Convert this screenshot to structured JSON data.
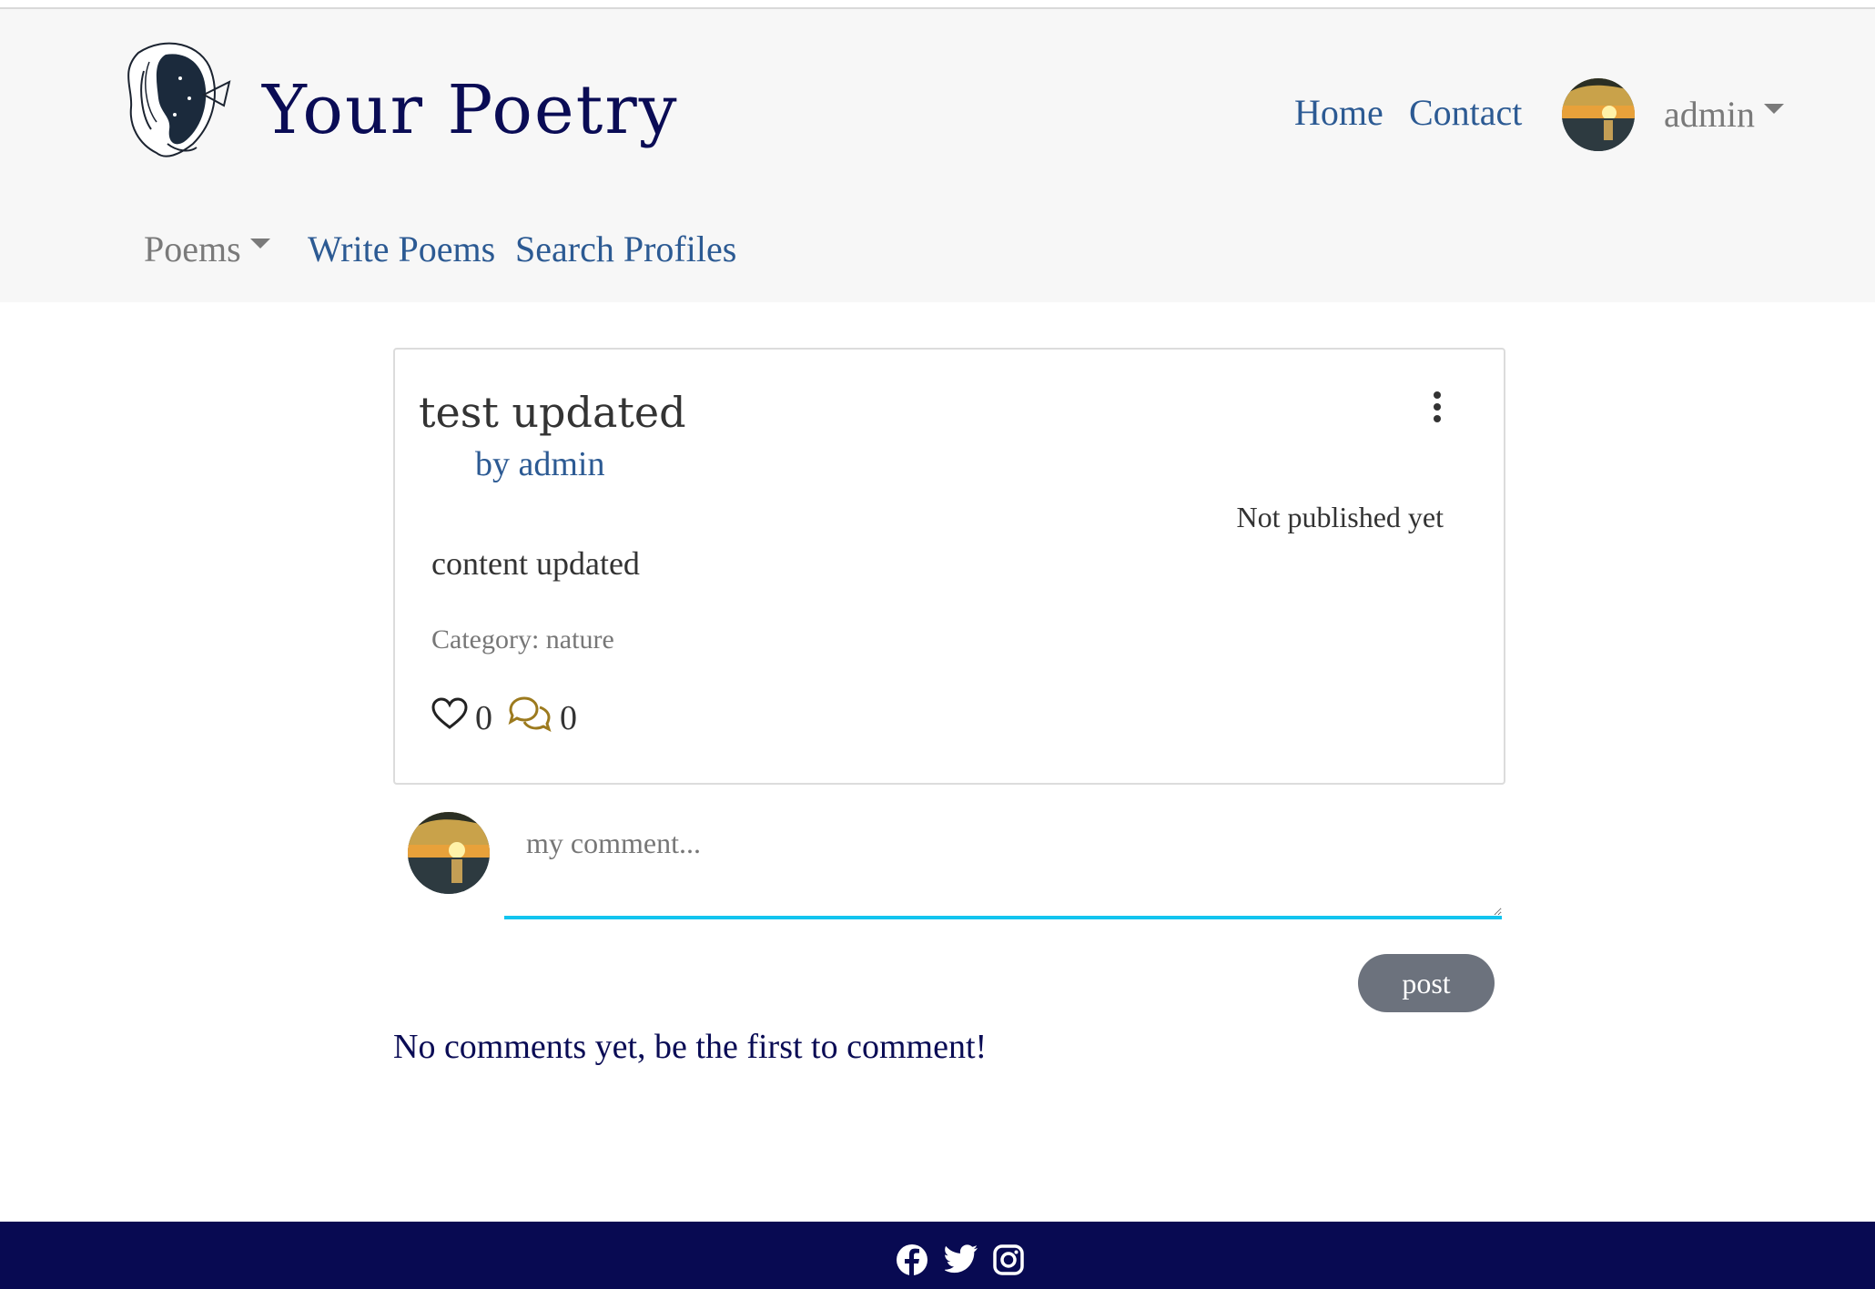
{
  "header": {
    "brand": "Your Poetry",
    "logo_icon": "woman-profile-logo-icon",
    "nav": {
      "home": "Home",
      "contact": "Contact",
      "user": "admin",
      "poems_menu": "Poems",
      "write_poems": "Write Poems",
      "search_profiles": "Search Profiles"
    }
  },
  "poem": {
    "title": "test updated",
    "author": "by admin",
    "status": "Not published yet",
    "content": "content updated",
    "category": "Category: nature",
    "likes": "0",
    "comments": "0",
    "like_icon": "heart-icon",
    "comment_icon": "comments-icon",
    "menu_icon": "kebab-menu-icon"
  },
  "comment_form": {
    "placeholder": "my comment...",
    "post_label": "post"
  },
  "comments_empty": "No comments yet, be the first to comment!",
  "footer": {
    "icons": [
      "facebook-icon",
      "twitter-icon",
      "instagram-icon"
    ]
  },
  "colors": {
    "brand": "#0a0c55",
    "link": "#2c5a93",
    "accent": "#12c4ef",
    "footer": "#080a52",
    "button": "#6c727d",
    "comment_icon": "#9c7a1e"
  }
}
